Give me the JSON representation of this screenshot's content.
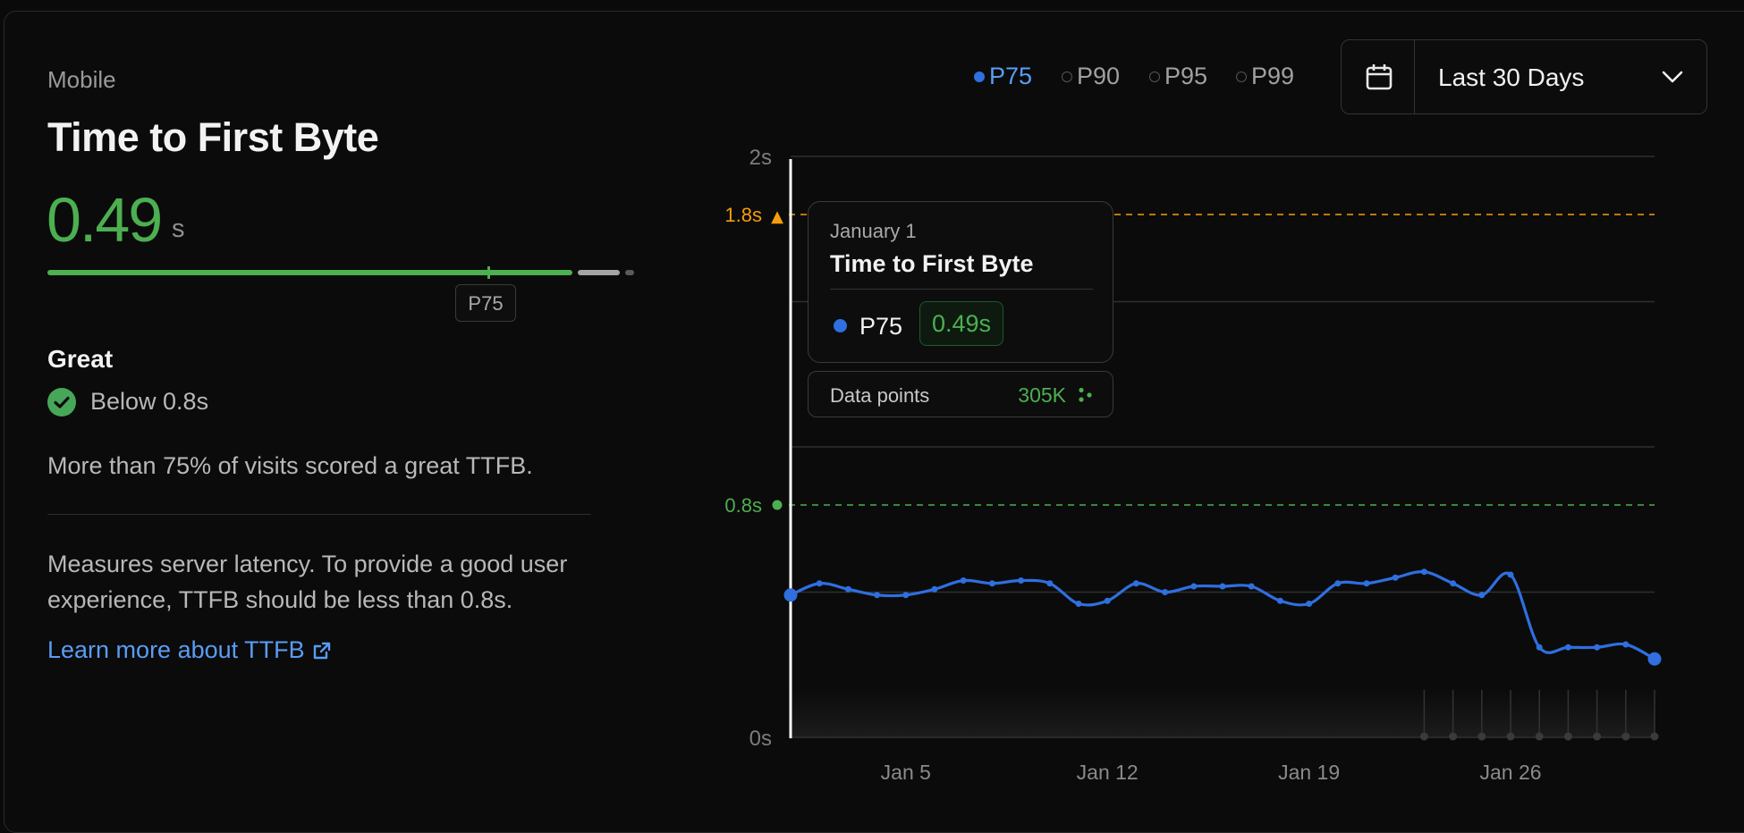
{
  "card": {
    "device": "Mobile",
    "metric_title": "Time to First Byte",
    "value": "0.49",
    "unit": "s",
    "score_marker_label": "P75",
    "rating": "Great",
    "rating_condition": "Below 0.8s",
    "summary": "More than 75% of visits scored a great TTFB.",
    "description": "Measures server latency. To provide a good user experience, TTFB should be less than 0.8s.",
    "learn_more_label": "Learn more about TTFB",
    "score_progress": 0.755
  },
  "percentiles": {
    "options": [
      "P75",
      "P90",
      "P95",
      "P99"
    ],
    "selected": "P75"
  },
  "date_range": {
    "label": "Last 30 Days"
  },
  "tooltip": {
    "date": "January 1",
    "title": "Time to First Byte",
    "series": "P75",
    "value": "0.49s",
    "data_points_label": "Data points",
    "data_points_value": "305K"
  },
  "colors": {
    "good": "#4caf50",
    "poor": "#f59e0b",
    "series": "#2f6fe0",
    "link": "#5a9cf5"
  },
  "chart_data": {
    "type": "line",
    "x": [
      "Jan 1",
      "Jan 2",
      "Jan 3",
      "Jan 4",
      "Jan 5",
      "Jan 6",
      "Jan 7",
      "Jan 8",
      "Jan 9",
      "Jan 10",
      "Jan 11",
      "Jan 12",
      "Jan 13",
      "Jan 14",
      "Jan 15",
      "Jan 16",
      "Jan 17",
      "Jan 18",
      "Jan 19",
      "Jan 20",
      "Jan 21",
      "Jan 22",
      "Jan 23",
      "Jan 24",
      "Jan 25",
      "Jan 26",
      "Jan 27",
      "Jan 28",
      "Jan 29",
      "Jan 30",
      "Jan 31"
    ],
    "series": [
      {
        "name": "P75",
        "values": [
          0.49,
          0.53,
          0.51,
          0.49,
          0.49,
          0.51,
          0.54,
          0.53,
          0.54,
          0.53,
          0.46,
          0.47,
          0.53,
          0.5,
          0.52,
          0.52,
          0.52,
          0.47,
          0.46,
          0.53,
          0.53,
          0.55,
          0.57,
          0.53,
          0.49,
          0.56,
          0.31,
          0.31,
          0.31,
          0.32,
          0.27
        ]
      }
    ],
    "ylim": [
      0,
      2
    ],
    "y_ticks": [
      "0s",
      "2s"
    ],
    "x_ticks": [
      "Jan 5",
      "Jan 12",
      "Jan 19",
      "Jan 26"
    ],
    "thresholds": [
      {
        "label": "1.8s",
        "value": 1.8,
        "color": "#f59e0b",
        "marker": "▲"
      },
      {
        "label": "0.8s",
        "value": 0.8,
        "color": "#4caf50",
        "marker": "●"
      }
    ],
    "grid": true,
    "legend": "top-right"
  }
}
